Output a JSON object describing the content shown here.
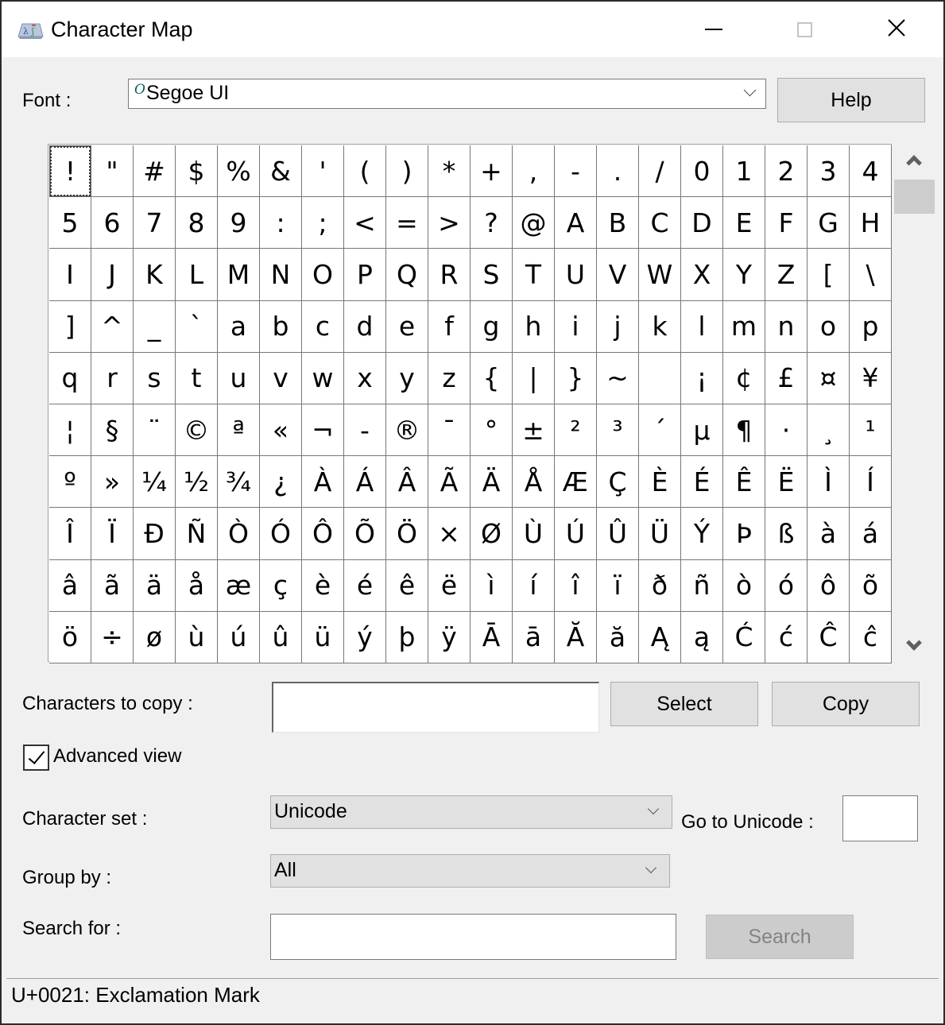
{
  "window": {
    "title": "Character Map",
    "icon": "charmap-app-icon",
    "controls": {
      "minimize": "minimize-icon",
      "maximize": "maximize-icon",
      "close": "close-icon"
    }
  },
  "font": {
    "label": "Font :",
    "selected": "Segoe UI",
    "type_icon_glyph": "O",
    "help_button": "Help"
  },
  "grid": {
    "columns": 20,
    "rows": 10,
    "selected_index": 0,
    "characters": [
      "!",
      "\"",
      "#",
      "$",
      "%",
      "&",
      "'",
      "(",
      ")",
      "*",
      "+",
      ",",
      "-",
      ".",
      "/",
      "0",
      "1",
      "2",
      "3",
      "4",
      "5",
      "6",
      "7",
      "8",
      "9",
      ":",
      ";",
      "<",
      "=",
      ">",
      "?",
      "@",
      "A",
      "B",
      "C",
      "D",
      "E",
      "F",
      "G",
      "H",
      "I",
      "J",
      "K",
      "L",
      "M",
      "N",
      "O",
      "P",
      "Q",
      "R",
      "S",
      "T",
      "U",
      "V",
      "W",
      "X",
      "Y",
      "Z",
      "[",
      "\\",
      "]",
      "^",
      "_",
      "`",
      "a",
      "b",
      "c",
      "d",
      "e",
      "f",
      "g",
      "h",
      "i",
      "j",
      "k",
      "l",
      "m",
      "n",
      "o",
      "p",
      "q",
      "r",
      "s",
      "t",
      "u",
      "v",
      "w",
      "x",
      "y",
      "z",
      "{",
      "|",
      "}",
      "~",
      " ",
      "¡",
      "¢",
      "£",
      "¤",
      "¥",
      "¦",
      "§",
      "¨",
      "©",
      "ª",
      "«",
      "¬",
      "-",
      "®",
      "¯",
      "°",
      "±",
      "²",
      "³",
      "´",
      "µ",
      "¶",
      "·",
      "¸",
      "¹",
      "º",
      "»",
      "¼",
      "½",
      "¾",
      "¿",
      "À",
      "Á",
      "Â",
      "Ã",
      "Ä",
      "Å",
      "Æ",
      "Ç",
      "È",
      "É",
      "Ê",
      "Ë",
      "Ì",
      "Í",
      "Î",
      "Ï",
      "Ð",
      "Ñ",
      "Ò",
      "Ó",
      "Ô",
      "Õ",
      "Ö",
      "×",
      "Ø",
      "Ù",
      "Ú",
      "Û",
      "Ü",
      "Ý",
      "Þ",
      "ß",
      "à",
      "á",
      "â",
      "ã",
      "ä",
      "å",
      "æ",
      "ç",
      "è",
      "é",
      "ê",
      "ë",
      "ì",
      "í",
      "î",
      "ï",
      "ð",
      "ñ",
      "ò",
      "ó",
      "ô",
      "õ",
      "ö",
      "÷",
      "ø",
      "ù",
      "ú",
      "û",
      "ü",
      "ý",
      "þ",
      "ÿ",
      "Ā",
      "ā",
      "Ă",
      "ă",
      "Ą",
      "ą",
      "Ć",
      "ć",
      "Ĉ",
      "ĉ"
    ]
  },
  "copy": {
    "label": "Characters to copy :",
    "value": "",
    "select_button": "Select",
    "copy_button": "Copy"
  },
  "advanced_view": {
    "label": "Advanced view",
    "checked": true
  },
  "character_set": {
    "label": "Character set :",
    "selected": "Unicode"
  },
  "goto_unicode": {
    "label": "Go to Unicode :",
    "value": ""
  },
  "group_by": {
    "label": "Group by :",
    "selected": "All"
  },
  "search": {
    "label": "Search for :",
    "value": "",
    "button": "Search",
    "button_enabled": false
  },
  "status": {
    "text": "U+0021: Exclamation Mark"
  }
}
